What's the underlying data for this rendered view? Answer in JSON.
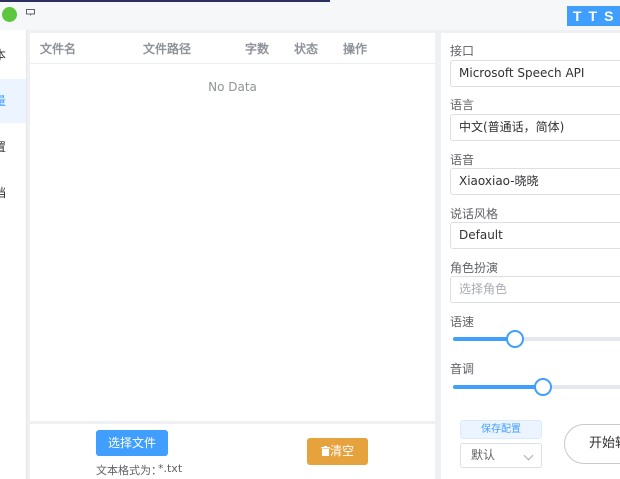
{
  "topbar": {
    "banner_text": "TTS"
  },
  "sidebar": {
    "items": [
      {
        "label": "本",
        "active": false
      },
      {
        "label": "量",
        "active": true
      },
      {
        "label": "置",
        "active": false
      },
      {
        "label": "档",
        "active": false
      }
    ]
  },
  "table": {
    "columns": [
      "文件名",
      "文件路径",
      "字数",
      "状态",
      "操作"
    ],
    "empty_text": "No Data"
  },
  "file_actions": {
    "select_label": "选择文件",
    "clear_label": "清空",
    "format_label": "文本格式为：",
    "format_value": "*.txt"
  },
  "settings": {
    "api_label": "接口",
    "api_value": "Microsoft Speech API",
    "language_label": "语言",
    "language_value": "中文(普通话，简体)",
    "voice_label": "语音",
    "voice_value": "Xiaoxiao-晓晓",
    "style_label": "说话风格",
    "style_value": "Default",
    "role_label": "角色扮演",
    "role_placeholder": "选择角色",
    "rate_label": "语速",
    "rate_fraction": 0.35,
    "pitch_label": "音调",
    "pitch_fraction": 0.51,
    "save_config_label": "保存配置",
    "preset_value": "默认",
    "start_label": "开始转"
  },
  "colors": {
    "accent": "#409eff",
    "warning": "#e6a23c",
    "success_dot": "#5cc63e"
  }
}
